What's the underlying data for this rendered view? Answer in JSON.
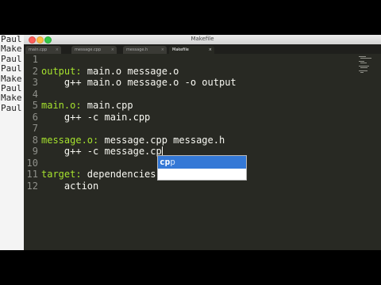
{
  "window": {
    "title": "Makefile"
  },
  "tabs": [
    {
      "label": "main.cpp",
      "active": false
    },
    {
      "label": "message.cpp",
      "active": false
    },
    {
      "label": "message.h",
      "active": false
    },
    {
      "label": "Makefile",
      "active": true
    }
  ],
  "terminal": {
    "lines": [
      "Paul",
      "Make",
      "Paul",
      "Paul",
      "Make",
      "Paul",
      "Make",
      "Paul"
    ]
  },
  "editor": {
    "lines": [
      {
        "num": "1",
        "target": "",
        "rest": ""
      },
      {
        "num": "2",
        "target": "output:",
        "rest": " main.o message.o"
      },
      {
        "num": "3",
        "target": "",
        "rest": "    g++ main.o message.o -o output"
      },
      {
        "num": "4",
        "target": "",
        "rest": ""
      },
      {
        "num": "5",
        "target": "main.o:",
        "rest": " main.cpp"
      },
      {
        "num": "6",
        "target": "",
        "rest": "    g++ -c main.cpp"
      },
      {
        "num": "7",
        "target": "",
        "rest": ""
      },
      {
        "num": "8",
        "target": "message.o:",
        "rest": " message.cpp message.h"
      },
      {
        "num": "9",
        "target": "",
        "rest": "    g++ -c message.cp"
      },
      {
        "num": "10",
        "target": "",
        "rest": ""
      },
      {
        "num": "11",
        "target": "target:",
        "rest": " dependencies"
      },
      {
        "num": "12",
        "target": "",
        "rest": "    action"
      }
    ]
  },
  "autocomplete": {
    "match": "cp",
    "rest": "p"
  },
  "colors": {
    "background": "#282923",
    "target": "#a6e22e",
    "text": "#f8f8f2",
    "line_numbers": "#8f908a",
    "selection": "#3478d6"
  }
}
